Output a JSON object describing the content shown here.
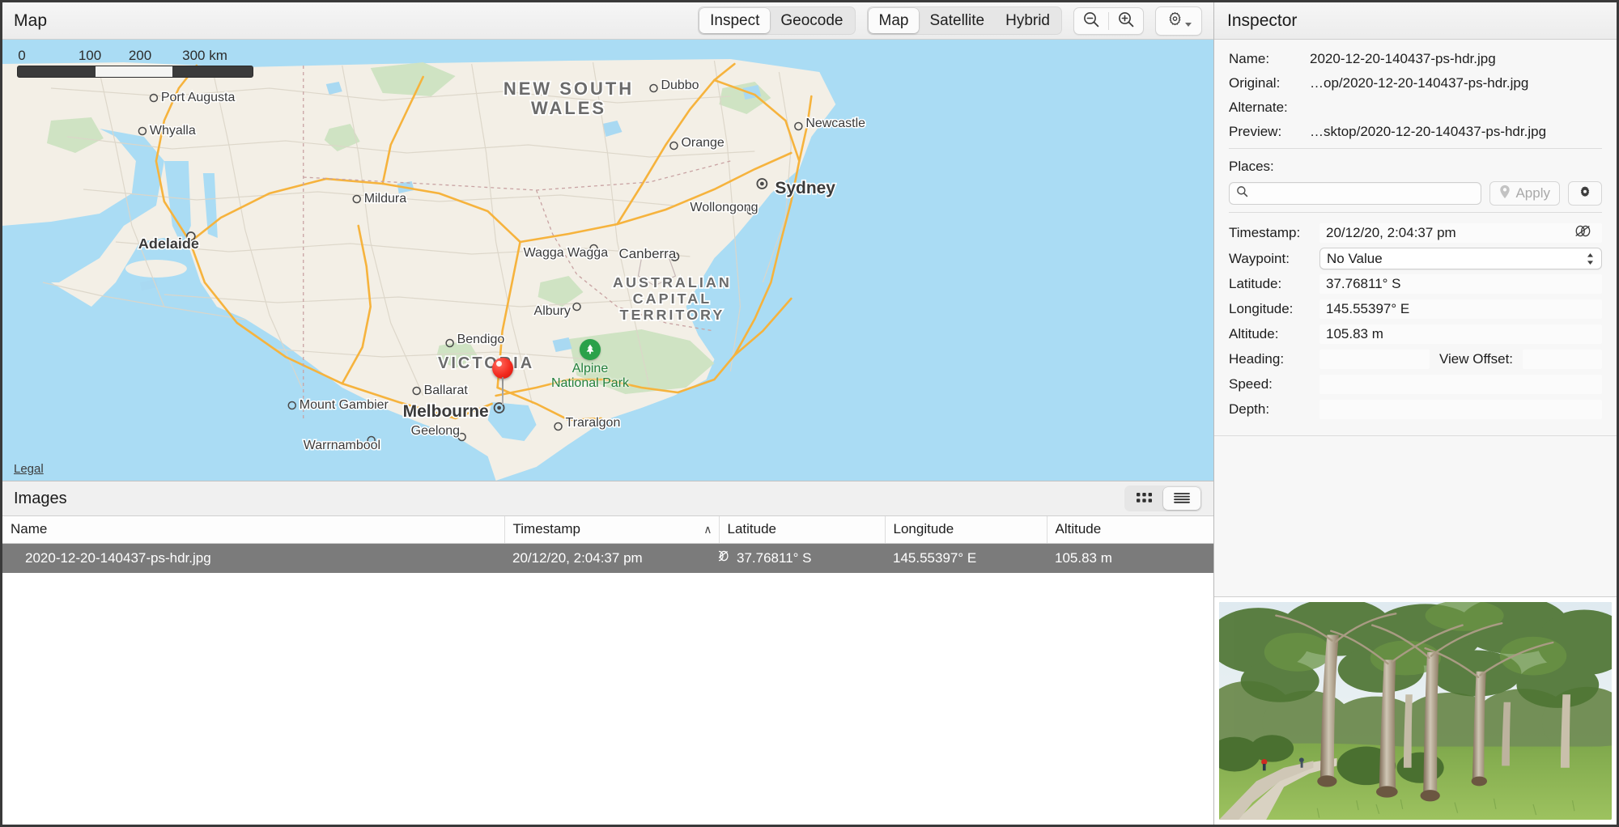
{
  "map_panel": {
    "title": "Map",
    "mode_tabs": [
      {
        "label": "Inspect",
        "active": true
      },
      {
        "label": "Geocode",
        "active": false
      }
    ],
    "layer_tabs": [
      {
        "label": "Map",
        "active": true
      },
      {
        "label": "Satellite",
        "active": false
      },
      {
        "label": "Hybrid",
        "active": false
      }
    ],
    "zoom_out_icon": "zoom-out-icon",
    "zoom_in_icon": "zoom-in-icon",
    "settings_icon": "gear-icon",
    "legal_link": "Legal",
    "scale_bar": {
      "unit_label": "300 km",
      "ticks": [
        "0",
        "100",
        "200",
        "300 km"
      ]
    },
    "labels": {
      "states": [
        "NEW SOUTH WALES",
        "VICTORIA",
        "AUSTRALIAN CAPITAL TERRITORY"
      ],
      "cities": [
        "Port Augusta",
        "Whyalla",
        "Adelaide",
        "Mount Gambier",
        "Warrnambool",
        "Ballarat",
        "Geelong",
        "Melbourne",
        "Bendigo",
        "Mildura",
        "Albury",
        "Wagga Wagga",
        "Canberra",
        "Traralgon",
        "Dubbo",
        "Orange",
        "Newcastle",
        "Sydney",
        "Wollongong"
      ],
      "park": "Alpine\nNational Park",
      "park_name_line1": "Alpine",
      "park_name_line2": "National Park"
    }
  },
  "images_panel": {
    "title": "Images",
    "view_modes": [
      {
        "icon": "grid-view-icon",
        "active": false
      },
      {
        "icon": "list-view-icon",
        "active": true
      }
    ],
    "columns": [
      "Name",
      "Timestamp",
      "Latitude",
      "Longitude",
      "Altitude"
    ],
    "sort_column": "Timestamp",
    "sort_caret": "∧",
    "rows": [
      {
        "name": "2020-12-20-140437-ps-hdr.jpg",
        "timestamp": "20/12/20, 2:04:37 pm",
        "latitude": "37.76811° S",
        "longitude": "145.55397° E",
        "altitude": "105.83 m",
        "no_geo_icon": "no-timezone-icon",
        "selected": true
      }
    ]
  },
  "inspector": {
    "title": "Inspector",
    "file_fields": [
      {
        "label": "Name:",
        "value": "2020-12-20-140437-ps-hdr.jpg"
      },
      {
        "label": "Original:",
        "value": "…op/2020-12-20-140437-ps-hdr.jpg"
      },
      {
        "label": "Alternate:",
        "value": ""
      },
      {
        "label": "Preview:",
        "value": "…sktop/2020-12-20-140437-ps-hdr.jpg"
      }
    ],
    "places": {
      "label": "Places:",
      "search_value": "",
      "search_placeholder": "",
      "search_icon": "search-icon",
      "apply_label": "Apply",
      "apply_icon": "map-pin-icon",
      "apply_enabled": false,
      "settings_icon": "gear-icon"
    },
    "data_fields": {
      "timestamp": {
        "label": "Timestamp:",
        "value": "20/12/20, 2:04:37 pm",
        "trailing_icon": "no-timezone-icon"
      },
      "waypoint": {
        "label": "Waypoint:",
        "value": "No Value",
        "type": "select"
      },
      "latitude": {
        "label": "Latitude:",
        "value": "37.76811° S"
      },
      "longitude": {
        "label": "Longitude:",
        "value": "145.55397° E"
      },
      "altitude": {
        "label": "Altitude:",
        "value": "105.83 m"
      },
      "heading": {
        "label": "Heading:",
        "value": ""
      },
      "view_offset": {
        "label": "View Offset:",
        "value": ""
      },
      "speed": {
        "label": "Speed:",
        "value": ""
      },
      "depth": {
        "label": "Depth:",
        "value": ""
      }
    },
    "preview_image": {
      "alt": "eucalyptus-forest-with-dirt-path"
    }
  },
  "colors": {
    "water": "#aadcf4",
    "land": "#f3efe6",
    "park_green": "#cde5c2",
    "highway": "#f6b33d",
    "road": "#d8d3c8",
    "pin_red": "#f32b20",
    "selection_gray": "#7b7b7b",
    "park_label_green": "#24803c",
    "chrome": "#f2f2f2"
  }
}
